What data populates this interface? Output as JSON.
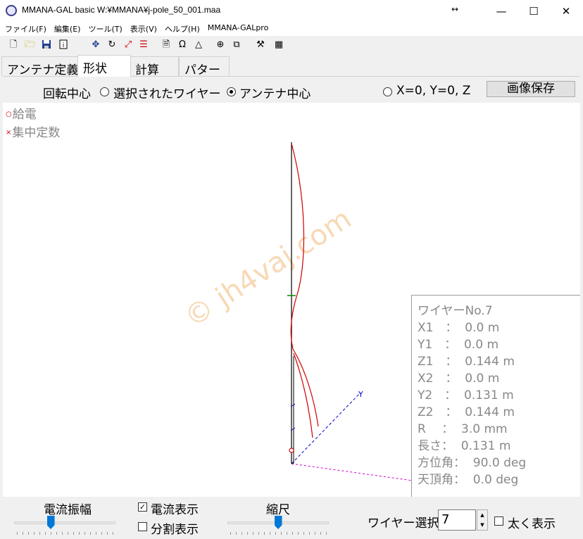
{
  "window": {
    "title": "MMANA-GAL basic W:¥MMANA¥j-pole_50_001.maa",
    "resize_glyph": "↔",
    "minimize_glyph": "—",
    "maximize_glyph": "☐",
    "close_glyph": "✕"
  },
  "menu": [
    "ファイル(F)",
    "編集(E)",
    "ツール(T)",
    "表示(V)",
    "ヘルプ(H)",
    "MMANA-GALpro"
  ],
  "toolbar": {
    "icons": [
      "new-file-icon",
      "open-folder-icon",
      "save-disk-icon",
      "info-icon",
      "move-arrows-icon",
      "rotate-icon",
      "zoom-icon",
      "wire-list-icon",
      "page-icon",
      "ohm-icon",
      "triangle-icon",
      "crosshair-icon",
      "copy-icon",
      "tools-icon",
      "calculator-icon"
    ]
  },
  "tabs": [
    {
      "label": "アンテナ定義"
    },
    {
      "label": "形状"
    },
    {
      "label": "計算"
    },
    {
      "label": "パターン"
    }
  ],
  "options": {
    "rotation_label": "回転中心",
    "radio_selected_wire": "選択されたワイヤー",
    "radio_antenna_center": "アンテナ中心",
    "radio_origin": "X=0, Y=0, Z",
    "save_image_button": "画像保存"
  },
  "legend": {
    "feed": "給電",
    "load": "集中定数"
  },
  "watermark": "© jh4vaj.com",
  "axis_label_y": "Y",
  "wire_info": {
    "title": "ワイヤーNo.7",
    "x1": "X1　：  0.0 m",
    "y1": "Y1　：  0.0 m",
    "z1": "Z1　：  0.144 m",
    "x2": "X2　：  0.0 m",
    "y2": "Y2　：  0.131 m",
    "z2": "Z2　：  0.144 m",
    "r": "R　 ：  3.0 mm",
    "length": "長さ：  0.131 m",
    "azimuth": "方位角：  90.0 deg",
    "zenith": "天頂角：  0.0 deg"
  },
  "bottom": {
    "current_amplitude_label": "電流振幅",
    "current_amplitude_level": 0.35,
    "show_current_label": "電流表示",
    "show_current_checked": true,
    "split_view_label": "分割表示",
    "split_view_checked": false,
    "scale_label": "縮尺",
    "scale_level": 0.5,
    "wire_select_label": "ワイヤー選択",
    "wire_select_value": "7",
    "thick_view_label": "太く表示",
    "thick_view_checked": false
  },
  "colors": {
    "current": "#cc0000",
    "wire": "#000000",
    "axis_y": "#0000cc",
    "axis_x": "#cc00cc"
  }
}
